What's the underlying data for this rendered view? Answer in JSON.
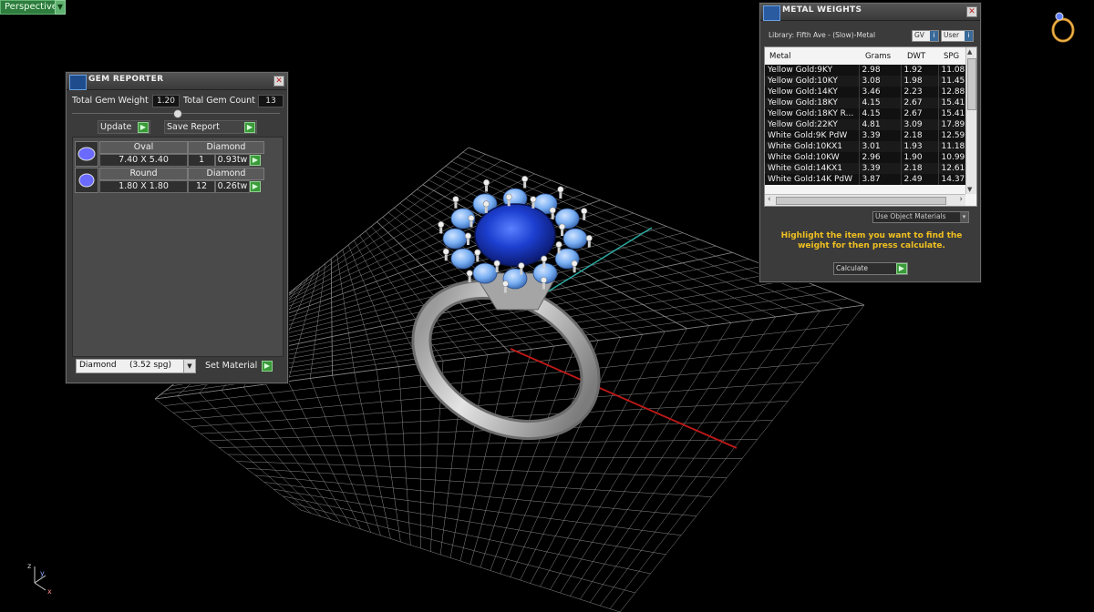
{
  "viewport": {
    "label": "Perspective",
    "axes": {
      "z": "z",
      "y": "y",
      "x": "x"
    }
  },
  "gem_reporter": {
    "title": "GEM REPORTER",
    "total_weight_label": "Total Gem Weight",
    "total_weight_value": "1.20",
    "total_count_label": "Total Gem Count",
    "total_count_value": "13",
    "update_label": "Update",
    "save_report_label": "Save Report",
    "rows": [
      {
        "shape": "Oval",
        "size": "7.40 X 5.40",
        "material": "Diamond",
        "count": "1",
        "weight": "0.93tw"
      },
      {
        "shape": "Round",
        "size": "1.80 X 1.80",
        "material": "Diamond",
        "count": "12",
        "weight": "0.26tw"
      }
    ],
    "material_select": "Diamond     (3.52 spg)",
    "set_material_label": "Set Material"
  },
  "metal_weights": {
    "title": "METAL WEIGHTS",
    "library": "Library: Fifth Ave - (Slow)-Metal",
    "gv_label": "GV",
    "user_label": "User",
    "columns": [
      "Metal",
      "Grams",
      "DWT",
      "SPG"
    ],
    "rows": [
      [
        "Yellow Gold:9KY",
        "2.98",
        "1.92",
        "11.08"
      ],
      [
        "Yellow Gold:10KY",
        "3.08",
        "1.98",
        "11.45"
      ],
      [
        "Yellow Gold:14KY",
        "3.46",
        "2.23",
        "12.88"
      ],
      [
        "Yellow Gold:18KY",
        "4.15",
        "2.67",
        "15.41"
      ],
      [
        "Yellow Gold:18KY R...",
        "4.15",
        "2.67",
        "15.41"
      ],
      [
        "Yellow Gold:22KY",
        "4.81",
        "3.09",
        "17.89"
      ],
      [
        "White Gold:9K PdW",
        "3.39",
        "2.18",
        "12.59"
      ],
      [
        "White Gold:10KX1",
        "3.01",
        "1.93",
        "11.18"
      ],
      [
        "White Gold:10KW",
        "2.96",
        "1.90",
        "10.99"
      ],
      [
        "White Gold:14KX1",
        "3.39",
        "2.18",
        "12.61"
      ],
      [
        "White Gold:14K PdW",
        "3.87",
        "2.49",
        "14.37"
      ]
    ],
    "use_object_materials": "Use Object Materials",
    "instruction": "Highlight the item you want to find the weight for then press calculate.",
    "calculate_label": "Calculate"
  },
  "colors": {
    "accent_green": "#3a9a3a",
    "instruction_yellow": "#f0c020",
    "sapphire": "#1840c8",
    "side_stone": "#6fa8f0"
  }
}
